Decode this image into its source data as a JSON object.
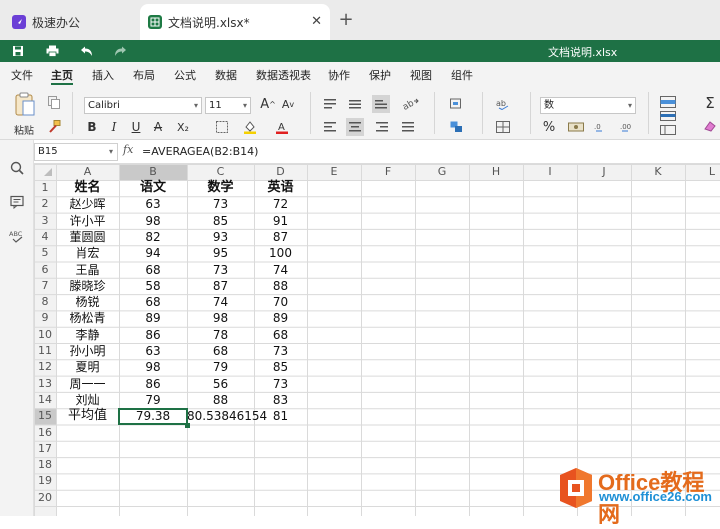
{
  "tabs": [
    {
      "label": "极速办公",
      "icon": "app-logo-icon"
    },
    {
      "label": "文档说明.xlsx*",
      "icon": "spreadsheet-icon",
      "close": "✕",
      "active": true
    }
  ],
  "new_tab": "+",
  "title": "文档说明.xlsx",
  "menu": [
    "文件",
    "主页",
    "插入",
    "布局",
    "公式",
    "数据",
    "数据透视表",
    "协作",
    "保护",
    "视图",
    "组件"
  ],
  "ribbon": {
    "paste_label": "粘贴",
    "font_name": "Calibri",
    "font_size": "11",
    "bold": "B",
    "italic": "I",
    "underline": "U",
    "strikethrough": "A",
    "subscript": "X₂",
    "number_format": "数",
    "percent": "%"
  },
  "formula_bar": {
    "cell_ref": "B15",
    "fx": "fx",
    "formula": "=AVERAGEA(B2:B14)"
  },
  "columns": [
    "A",
    "B",
    "C",
    "D",
    "E",
    "F",
    "G",
    "H",
    "I",
    "J",
    "K",
    "L"
  ],
  "rows": [
    "1",
    "2",
    "3",
    "4",
    "5",
    "6",
    "7",
    "8",
    "9",
    "10",
    "11",
    "12",
    "13",
    "14",
    "15",
    "16",
    "17",
    "18",
    "19",
    "20"
  ],
  "table": {
    "headers": [
      "姓名",
      "语文",
      "数学",
      "英语"
    ],
    "data": [
      [
        "赵少晖",
        "63",
        "73",
        "72"
      ],
      [
        "许小平",
        "98",
        "85",
        "91"
      ],
      [
        "董圆圆",
        "82",
        "93",
        "87"
      ],
      [
        "肖宏",
        "94",
        "95",
        "100"
      ],
      [
        "王晶",
        "68",
        "73",
        "74"
      ],
      [
        "滕晓珍",
        "58",
        "87",
        "88"
      ],
      [
        "杨锐",
        "68",
        "74",
        "70"
      ],
      [
        "杨松青",
        "89",
        "98",
        "89"
      ],
      [
        "李静",
        "86",
        "78",
        "68"
      ],
      [
        "孙小明",
        "63",
        "68",
        "73"
      ],
      [
        "夏明",
        "98",
        "79",
        "85"
      ],
      [
        "周一一",
        "86",
        "56",
        "73"
      ],
      [
        "刘灿",
        "79",
        "88",
        "83"
      ]
    ],
    "summary": [
      "平均值",
      "79.38",
      "80.53846154",
      "81"
    ]
  },
  "selected_cell": "B15",
  "watermark": {
    "brand": "Office教程网",
    "url": "www.office26.com"
  },
  "colors": {
    "accent": "#1e7145",
    "brand_orange": "#e46b1c",
    "brand_blue": "#1e90d6"
  }
}
